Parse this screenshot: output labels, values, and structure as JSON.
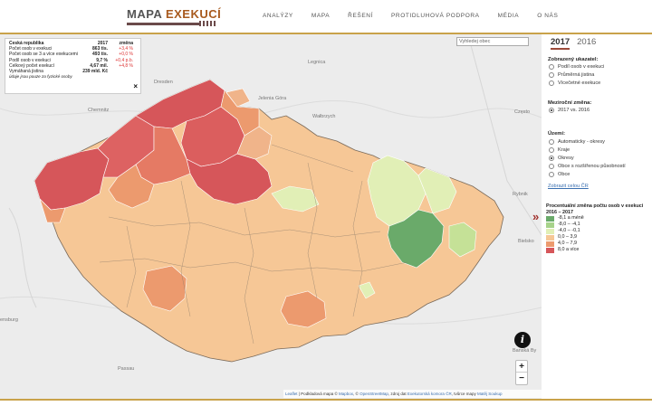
{
  "header": {
    "logo_main": "MAPA",
    "logo_accent": "EXEKUCÍ",
    "nav": [
      "ANALÝZY",
      "MAPA",
      "ŘEŠENÍ",
      "PROTIDLUHOVÁ PODPORA",
      "MÉDIA",
      "O NÁS"
    ]
  },
  "info_box": {
    "header": {
      "label": "Česká republika",
      "value": "2017",
      "change": "změna"
    },
    "rows": [
      {
        "label": "Počet osob v exekuci",
        "value": "863 tis.",
        "change": "+3,4 %"
      },
      {
        "label": "Počet osob se 3 a více exekucemi",
        "value": "493 tis.",
        "change": "+0,0 %"
      },
      {
        "label": "Podíl osob v exekuci",
        "value": "9,7 %",
        "change": "+0,4 p.b."
      },
      {
        "label": "Celkový počet exekucí",
        "value": "4,67 mil.",
        "change": "+4,8 %"
      },
      {
        "label": "Vymáhaná jistina",
        "value": "239 mld. Kč",
        "change": ""
      }
    ],
    "note": "údaje jsou pouze za fyzické osoby",
    "close": "×"
  },
  "search": {
    "placeholder": "Vyhledej obec"
  },
  "map_labels": {
    "dresden": "Dresden",
    "legnica": "Legnica",
    "chemnitz": "Chemnitz",
    "jelenia": "Jelenia Góra",
    "walbrzych": "Wałbrzych",
    "czesto": "Często",
    "rybnik": "Rybnik",
    "bielsko": "Bielsko",
    "banska": "Banská By",
    "ensburg": "ensburg",
    "passau": "Passau"
  },
  "info_button": "i",
  "zoom": {
    "plus": "+",
    "minus": "−"
  },
  "attribution": {
    "leaflet": "Leaflet",
    "text1": " | Podkladová mapa © ",
    "mapbox": "Mapbox",
    "text2": ", © ",
    "osm": "OpenStreetMap",
    "text3": ", zdroj dat ",
    "eks": "Exekutorská komora ČR",
    "text4": ", tvůrce mapy ",
    "author": "Matěj Soukup"
  },
  "toggle": "»",
  "sidebar": {
    "years": [
      "2017",
      "2016"
    ],
    "indicator_title": "Zobrazený ukazatel:",
    "indicators": [
      "Podíl osob v exekuci",
      "Průměrná jistina",
      "Vícečetné exekuce"
    ],
    "change_title": "Meziroční změna:",
    "change_options": [
      "2017 vs. 2016"
    ],
    "area_title": "Území:",
    "areas": [
      "Automaticky - okresy",
      "Kraje",
      "Okresy",
      "Obce s rozšířenou působností",
      "Obce"
    ],
    "show_all": "Zobrazit celou ČR",
    "legend_title": "Procentuální změna počtu osob v exekuci 2016 – 2017",
    "legend": [
      {
        "label": "-8,1 a méně",
        "color": "#6aaa6a"
      },
      {
        "label": "-8,0 – -4,1",
        "color": "#a7d38a"
      },
      {
        "label": "-4,0 – -0,1",
        "color": "#e1efb6"
      },
      {
        "label": "0,0 – 3,9",
        "color": "#f6c796"
      },
      {
        "label": "4,0 – 7,9",
        "color": "#ec9a6e"
      },
      {
        "label": "8,0 a více",
        "color": "#d6565a"
      }
    ]
  }
}
